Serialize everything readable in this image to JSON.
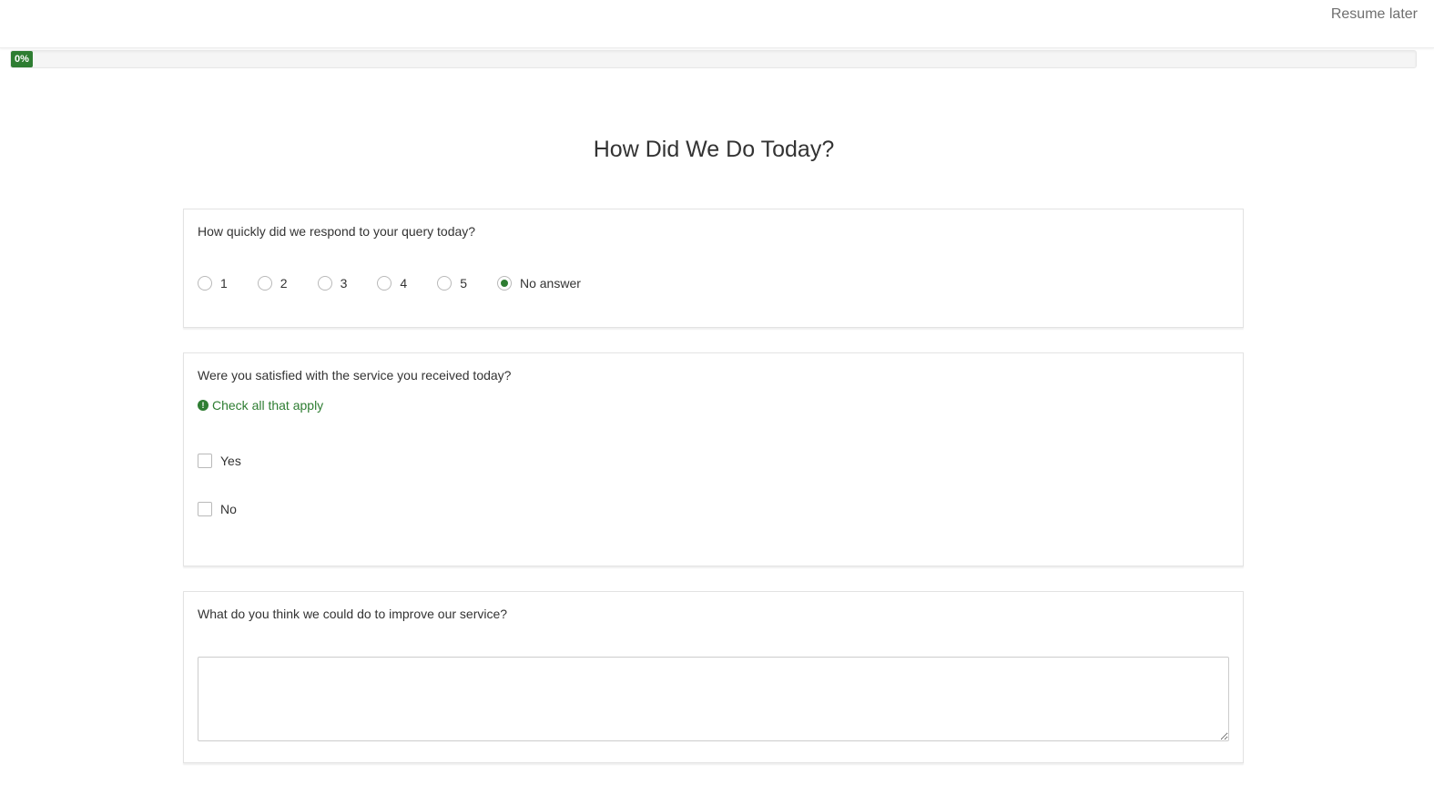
{
  "header": {
    "resume_label": "Resume later"
  },
  "progress": {
    "percent_label": "0%",
    "value": 0,
    "fill_color": "#2e7d32"
  },
  "survey": {
    "title": "How Did We Do Today?"
  },
  "questions": [
    {
      "text": "How quickly did we respond to your query today?",
      "type": "radio",
      "options": [
        "1",
        "2",
        "3",
        "4",
        "5",
        "No answer"
      ],
      "selected": "No answer"
    },
    {
      "text": "Were you satisfied with the service you received today?",
      "type": "checkbox",
      "help": "Check all that apply",
      "help_icon": "exclamation-circle-icon",
      "options": [
        "Yes",
        "No"
      ],
      "checked": []
    },
    {
      "text": "What do you think we could do to improve our service?",
      "type": "textarea",
      "value": ""
    }
  ],
  "colors": {
    "accent": "#2e7d32",
    "text": "#333333",
    "border": "#e3e3e3"
  }
}
